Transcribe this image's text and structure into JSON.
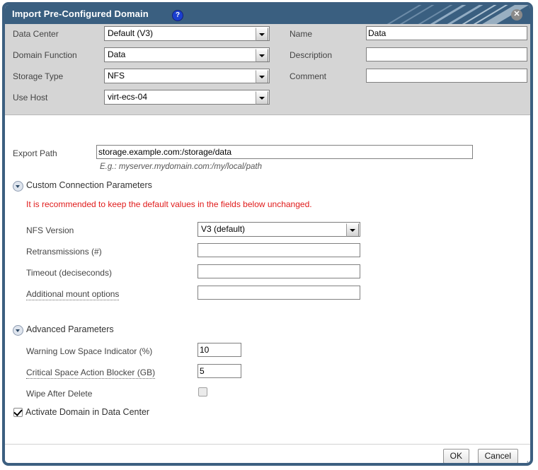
{
  "window": {
    "title": "Import Pre-Configured Domain",
    "help_icon": "question-mark-icon",
    "close_icon": "✕",
    "accent_color": "#3a5f80",
    "panel_color": "#d5d5d5",
    "warning_color": "#e01b1b"
  },
  "top_panel": {
    "left_fields": [
      {
        "label": "Data Center",
        "value": "Default (V3)",
        "type": "select"
      },
      {
        "label": "Domain Function",
        "value": "Data",
        "type": "select"
      },
      {
        "label": "Storage Type",
        "value": "NFS",
        "type": "select"
      },
      {
        "label": "Use Host",
        "value": "virt-ecs-04",
        "type": "select"
      }
    ],
    "right_fields": [
      {
        "label": "Name",
        "value": "Data",
        "type": "text"
      },
      {
        "label": "Description",
        "value": "",
        "type": "text"
      },
      {
        "label": "Comment",
        "value": "",
        "type": "text"
      }
    ]
  },
  "export_path": {
    "label": "Export Path",
    "value": "storage.example.com:/storage/data",
    "hint": "E.g.: myserver.mydomain.com:/my/local/path"
  },
  "custom_connection": {
    "section_label": "Custom Connection Parameters",
    "warning": "It is recommended to keep the default values in the fields below unchanged.",
    "fields": [
      {
        "label": "NFS Version",
        "value": "V3 (default)",
        "type": "select",
        "dotted": false
      },
      {
        "label": "Retransmissions (#)",
        "value": "",
        "type": "text",
        "dotted": false
      },
      {
        "label": "Timeout (deciseconds)",
        "value": "",
        "type": "text",
        "dotted": false
      },
      {
        "label": "Additional mount options",
        "value": "",
        "type": "text",
        "dotted": true
      }
    ]
  },
  "advanced": {
    "section_label": "Advanced Parameters",
    "fields": [
      {
        "label": "Warning Low Space Indicator (%)",
        "value": "10",
        "type": "text",
        "dotted": false
      },
      {
        "label": "Critical Space Action Blocker (GB)",
        "value": "5",
        "type": "text",
        "dotted": true
      }
    ],
    "wipe_after_delete": {
      "label": "Wipe After Delete",
      "checked": false
    }
  },
  "activate_domain": {
    "label": "Activate Domain in Data Center",
    "checked": true
  },
  "footer": {
    "ok_label": "OK",
    "cancel_label": "Cancel"
  }
}
